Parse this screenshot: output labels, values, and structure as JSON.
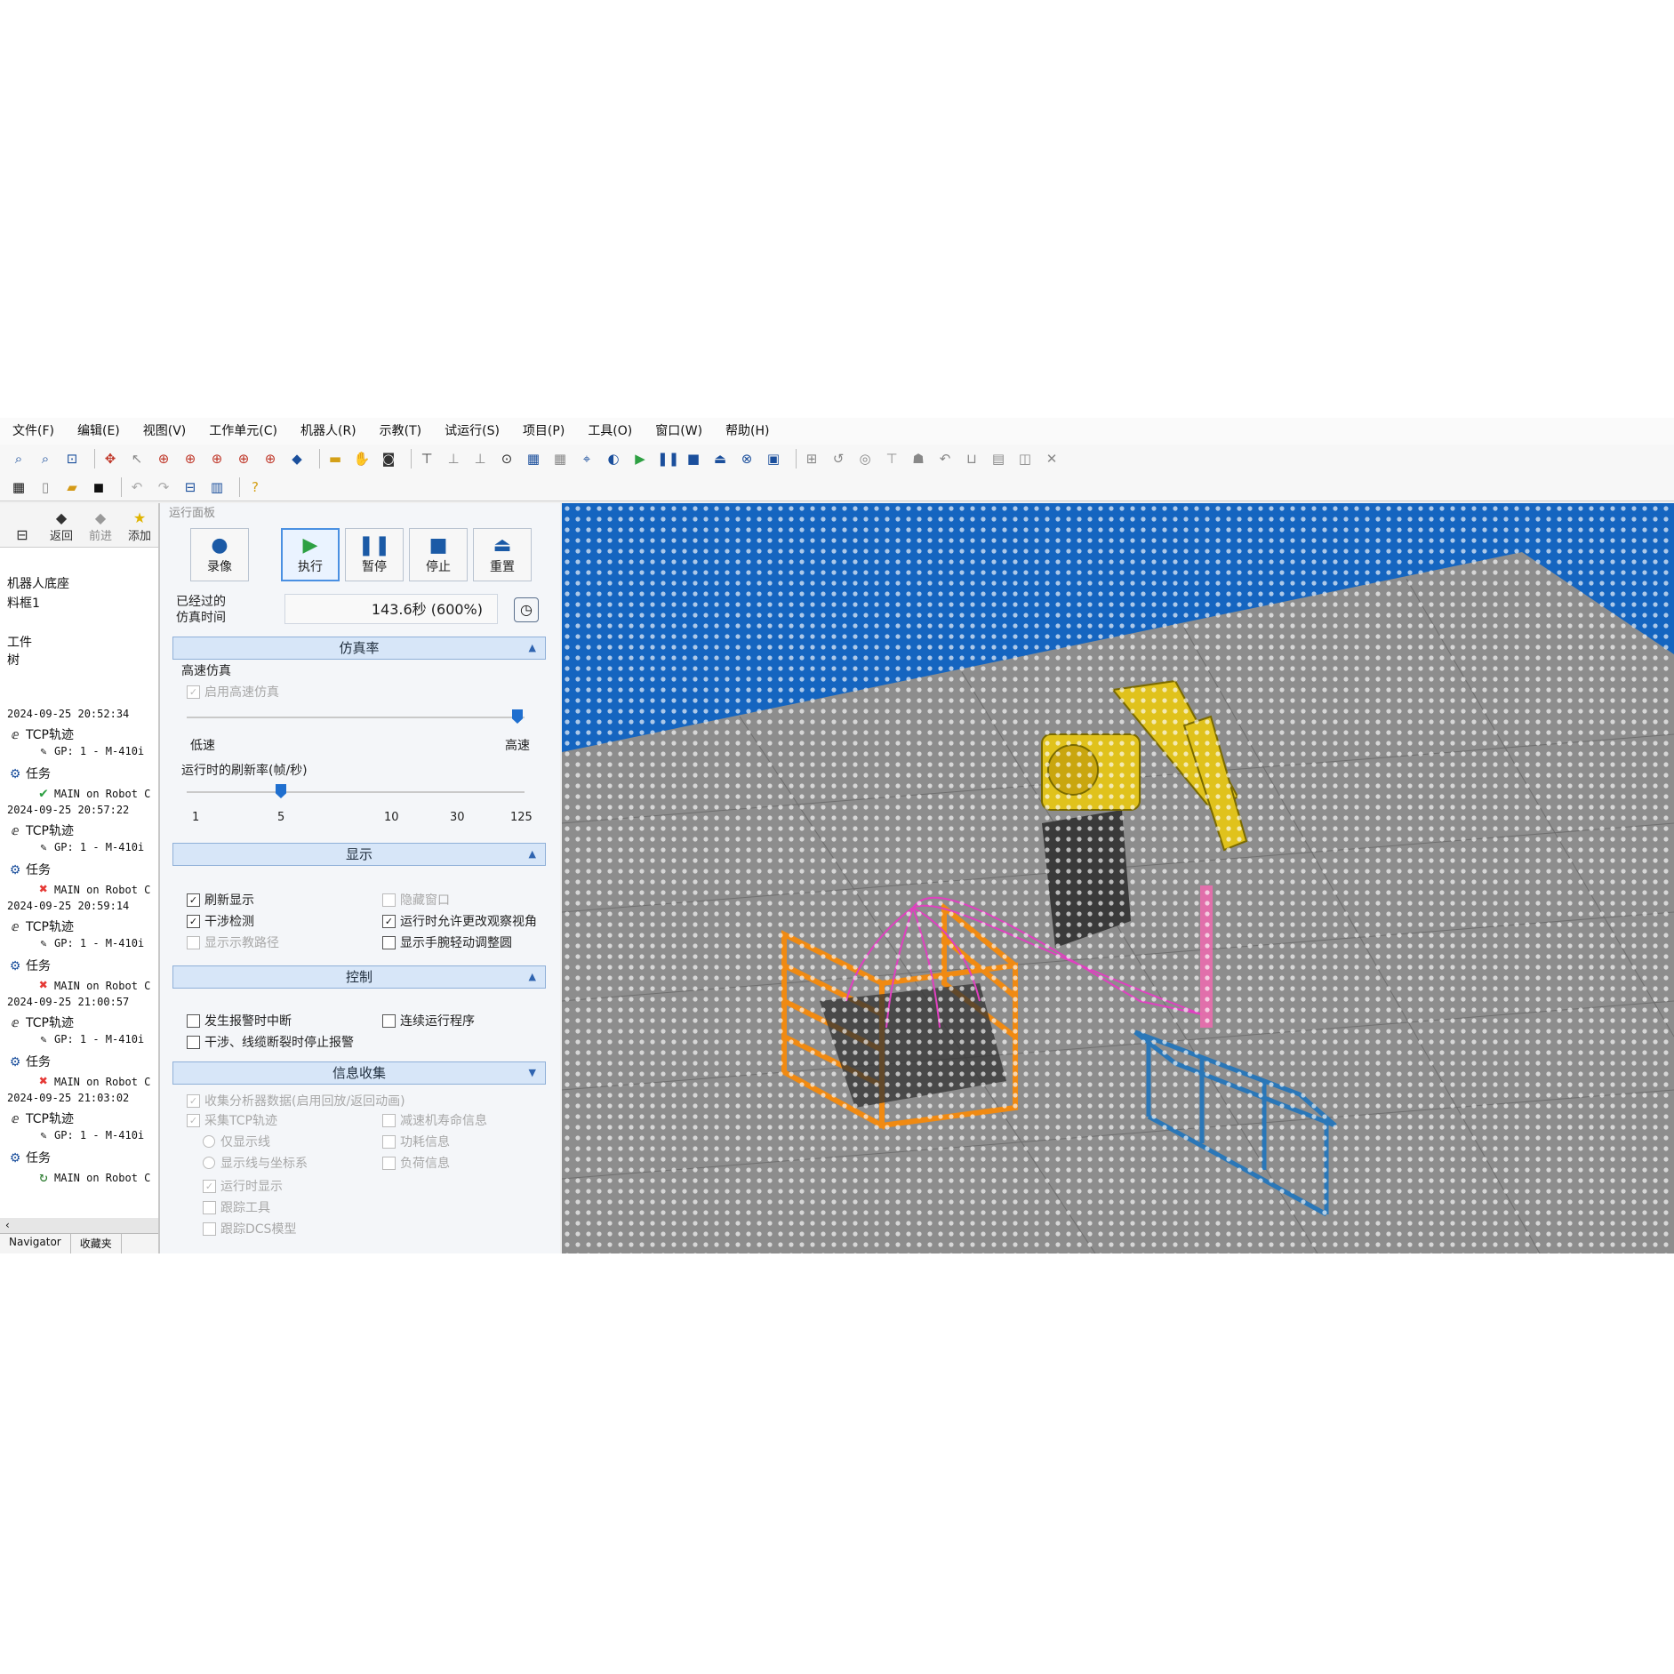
{
  "menu": [
    "文件(F)",
    "编辑(E)",
    "视图(V)",
    "工作单元(C)",
    "机器人(R)",
    "示教(T)",
    "试运行(S)",
    "项目(P)",
    "工具(O)",
    "窗口(W)",
    "帮助(H)"
  ],
  "tree": {
    "nav": {
      "back": "返回",
      "forward": "前进",
      "add": "添加"
    },
    "items": [
      "机器人底座",
      "料框1",
      "工件",
      "树",
      "2024-09-25 20:52:34",
      "TCP轨迹",
      "GP: 1 - M-410i",
      "任务",
      "MAIN on Robot C",
      "2024-09-25 20:57:22",
      "TCP轨迹",
      "GP: 1 - M-410i",
      "任务",
      "MAIN on Robot C",
      "2024-09-25 20:59:14",
      "TCP轨迹",
      "GP: 1 - M-410i",
      "任务",
      "MAIN on Robot C",
      "2024-09-25 21:00:57",
      "TCP轨迹",
      "GP: 1 - M-410i",
      "任务",
      "MAIN on Robot C",
      "2024-09-25 21:03:02",
      "TCP轨迹",
      "GP: 1 - M-410i",
      "任务",
      "MAIN on Robot C"
    ],
    "tabs": [
      "Navigator",
      "收藏夹"
    ]
  },
  "panel": {
    "title": "运行面板",
    "buttons": {
      "record": "录像",
      "run": "执行",
      "pause": "暂停",
      "stop": "停止",
      "reset": "重置"
    },
    "elapsed_label_1": "已经过的",
    "elapsed_label_2": "仿真时间",
    "elapsed_value": "143.6秒 (600%)",
    "sections": {
      "sim_rate": "仿真率",
      "display": "显示",
      "control": "控制",
      "collect": "信息收集"
    },
    "high_speed_title": "高速仿真",
    "enable_high_speed": "启用高速仿真",
    "low_speed": "低速",
    "high_speed": "高速",
    "refresh_rate_label": "运行时的刷新率(帧/秒)",
    "refresh_ticks": [
      "1",
      "5",
      "10",
      "30",
      "125"
    ],
    "display_options": {
      "refresh_display": "刷新显示",
      "collision_check": "干涉检测",
      "show_teach_path": "显示示教路径",
      "hide_window": "隐藏窗口",
      "allow_view_change": "运行时允许更改观察视角",
      "show_hand_circle": "显示手腕轻动调整圆"
    },
    "control_options": {
      "stop_on_alarm": "发生报警时中断",
      "continuous_run": "连续运行程序",
      "stop_alarm_collision": "干涉、线缆断裂时停止报警"
    },
    "collect_options": {
      "collect_analysis": "收集分析器数据(启用回放/返回动画)",
      "collect_tcp": "采集TCP轨迹",
      "reducer_life": "减速机寿命信息",
      "show_line_only": "仅显示线",
      "power_info": "功耗信息",
      "show_line_coord": "显示线与坐标系",
      "load_info": "负荷信息",
      "show_on_run": "运行时显示",
      "track_tool": "跟踪工具",
      "track_dcs": "跟踪DCS模型"
    }
  },
  "colors": {
    "sky": "#1565c0",
    "floor": "#8d8d8d",
    "robot": "#e0c21c",
    "fence": "#f08a12",
    "path": "#e040c0",
    "conveyor": "#2a77b8",
    "section_header": "#d7e6f8"
  },
  "tree_status_icons": [
    "check-icon",
    "error-icon",
    "error-icon",
    "error-icon",
    "running-icon"
  ]
}
